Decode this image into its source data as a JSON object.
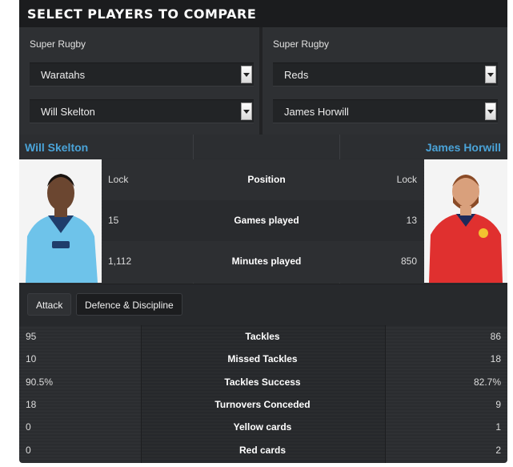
{
  "header": {
    "title": "SELECT PLAYERS TO COMPARE"
  },
  "left": {
    "league": "Super Rugby",
    "team": "Waratahs",
    "player": "Will Skelton",
    "position": "Lock",
    "games": "15",
    "minutes": "1,112"
  },
  "right": {
    "league": "Super Rugby",
    "team": "Reds",
    "player": "James Horwill",
    "position": "Lock",
    "games": "13",
    "minutes": "850"
  },
  "labels": {
    "position": "Position",
    "games": "Games played",
    "minutes": "Minutes played"
  },
  "tabs": [
    "Attack",
    "Defence & Discipline"
  ],
  "stats": [
    {
      "label": "Tackles",
      "left": "95",
      "right": "86"
    },
    {
      "label": "Missed Tackles",
      "left": "10",
      "right": "18"
    },
    {
      "label": "Tackles Success",
      "left": "90.5%",
      "right": "82.7%"
    },
    {
      "label": "Turnovers Conceded",
      "left": "18",
      "right": "9"
    },
    {
      "label": "Yellow cards",
      "left": "0",
      "right": "1"
    },
    {
      "label": "Red cards",
      "left": "0",
      "right": "2"
    }
  ],
  "colors": {
    "accent": "#4aa3d8",
    "waratahs": "#5eb6e4",
    "reds": "#e0302f"
  }
}
